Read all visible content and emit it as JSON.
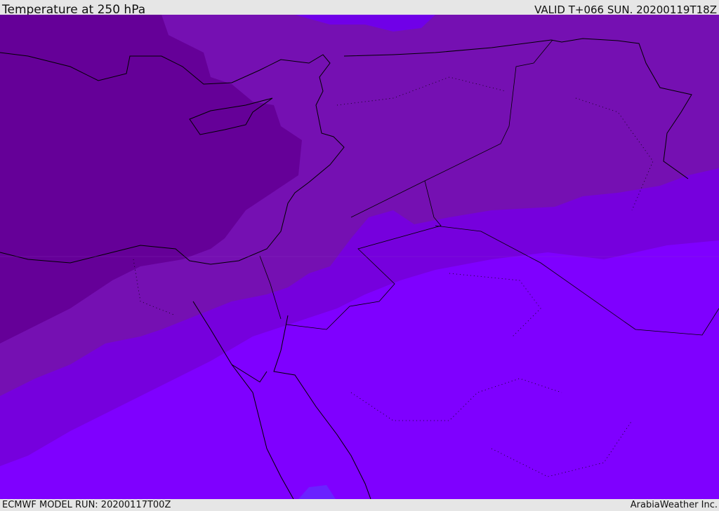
{
  "header": {
    "title": "Temperature at 250 hPa",
    "valid_time": "VALID T+066 SUN. 20200119T18Z"
  },
  "footer": {
    "model_run": "ECMWF MODEL RUN: 20200117T00Z",
    "credit": "ArabiaWeather Inc."
  },
  "map": {
    "variable": "temperature",
    "level_hpa": 250,
    "band_colors": [
      "#650098",
      "#7510b2",
      "#7600dd",
      "#7f00ff",
      "#6a22ff"
    ]
  }
}
